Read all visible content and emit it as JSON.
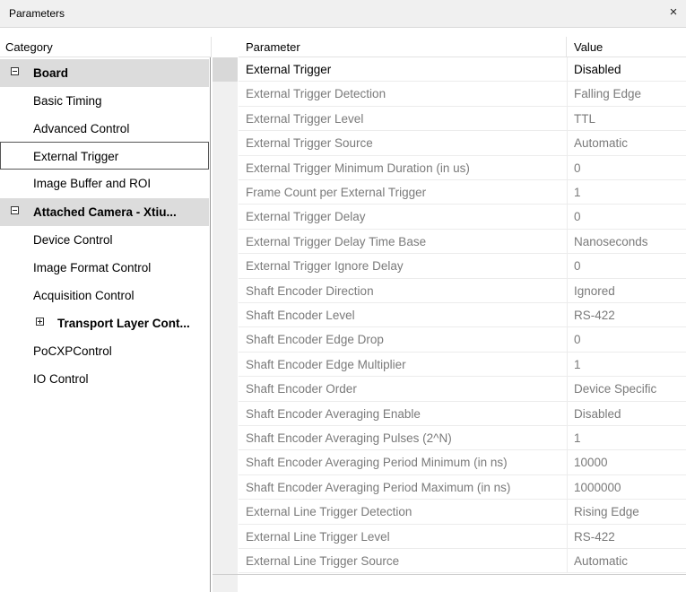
{
  "window": {
    "title": "Parameters",
    "close_glyph": "×"
  },
  "columns": {
    "category": "Category",
    "parameter": "Parameter",
    "value": "Value"
  },
  "categories": [
    {
      "label": "Board",
      "type": "group",
      "expander": "minus"
    },
    {
      "label": "Basic Timing",
      "type": "item"
    },
    {
      "label": "Advanced Control",
      "type": "item"
    },
    {
      "label": "External Trigger",
      "type": "item",
      "selected": true
    },
    {
      "label": "Image Buffer and ROI",
      "type": "item"
    },
    {
      "label": "Attached Camera - Xtiu...",
      "type": "group",
      "expander": "minus"
    },
    {
      "label": "Device Control",
      "type": "item"
    },
    {
      "label": "Image Format Control",
      "type": "item"
    },
    {
      "label": "Acquisition Control",
      "type": "item"
    },
    {
      "label": "Transport Layer Cont...",
      "type": "subgroup",
      "expander": "plus"
    },
    {
      "label": "PoCXPControl",
      "type": "item"
    },
    {
      "label": "IO Control",
      "type": "item"
    }
  ],
  "parameters": [
    {
      "name": "External Trigger",
      "value": "Disabled",
      "enabled": true
    },
    {
      "name": "External Trigger Detection",
      "value": "Falling Edge",
      "enabled": false
    },
    {
      "name": "External Trigger Level",
      "value": "TTL",
      "enabled": false
    },
    {
      "name": "External Trigger Source",
      "value": "Automatic",
      "enabled": false
    },
    {
      "name": "External Trigger Minimum Duration (in us)",
      "value": "0",
      "enabled": false
    },
    {
      "name": "Frame Count per External Trigger",
      "value": "1",
      "enabled": false
    },
    {
      "name": "External Trigger Delay",
      "value": "0",
      "enabled": false
    },
    {
      "name": "External Trigger Delay Time Base",
      "value": "Nanoseconds",
      "enabled": false
    },
    {
      "name": "External Trigger Ignore Delay",
      "value": "0",
      "enabled": false
    },
    {
      "name": "Shaft Encoder Direction",
      "value": "Ignored",
      "enabled": false
    },
    {
      "name": "Shaft Encoder Level",
      "value": "RS-422",
      "enabled": false
    },
    {
      "name": "Shaft Encoder Edge Drop",
      "value": "0",
      "enabled": false
    },
    {
      "name": "Shaft Encoder Edge Multiplier",
      "value": "1",
      "enabled": false
    },
    {
      "name": "Shaft Encoder Order",
      "value": "Device Specific",
      "enabled": false
    },
    {
      "name": "Shaft Encoder Averaging Enable",
      "value": "Disabled",
      "enabled": false
    },
    {
      "name": "Shaft Encoder Averaging Pulses (2^N)",
      "value": "1",
      "enabled": false
    },
    {
      "name": "Shaft Encoder Averaging Period Minimum (in ns)",
      "value": "10000",
      "enabled": false
    },
    {
      "name": "Shaft Encoder Averaging Period Maximum (in ns)",
      "value": "1000000",
      "enabled": false
    },
    {
      "name": "External Line Trigger Detection",
      "value": "Rising Edge",
      "enabled": false
    },
    {
      "name": "External Line Trigger Level",
      "value": "RS-422",
      "enabled": false
    },
    {
      "name": "External Line Trigger Source",
      "value": "Automatic",
      "enabled": false
    }
  ],
  "colors": {
    "group_bg": "#dcdcdc",
    "disabled_text": "#7a7a7a",
    "header_bg": "#f0f0f0"
  }
}
